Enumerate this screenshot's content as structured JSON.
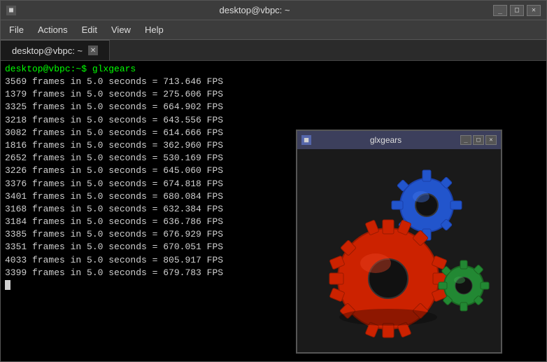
{
  "titlebar": {
    "title": "desktop@vbpc: ~",
    "min_btn": "_",
    "max_btn": "□",
    "close_btn": "✕",
    "icon": "■"
  },
  "menubar": {
    "items": [
      {
        "label": "File"
      },
      {
        "label": "Actions"
      },
      {
        "label": "Edit"
      },
      {
        "label": "View"
      },
      {
        "label": "Help"
      }
    ]
  },
  "tab": {
    "label": "desktop@vbpc: ~",
    "close": "✕"
  },
  "terminal": {
    "prompt": "desktop@vbpc:~$ glxgears",
    "lines": [
      "3569 frames in 5.0 seconds = 713.646 FPS",
      "1379 frames in 5.0 seconds = 275.606 FPS",
      "3325 frames in 5.0 seconds = 664.902 FPS",
      "3218 frames in 5.0 seconds = 643.556 FPS",
      "3082 frames in 5.0 seconds = 614.666 FPS",
      "1816 frames in 5.0 seconds = 362.960 FPS",
      "2652 frames in 5.0 seconds = 530.169 FPS",
      "3226 frames in 5.0 seconds = 645.060 FPS",
      "3376 frames in 5.0 seconds = 674.818 FPS",
      "3401 frames in 5.0 seconds = 680.084 FPS",
      "3168 frames in 5.0 seconds = 632.384 FPS",
      "3184 frames in 5.0 seconds = 636.786 FPS",
      "3385 frames in 5.0 seconds = 676.929 FPS",
      "3351 frames in 5.0 seconds = 670.051 FPS",
      "4033 frames in 5.0 seconds = 805.917 FPS",
      "3399 frames in 5.0 seconds = 679.783 FPS"
    ]
  },
  "glxgears_window": {
    "title": "glxgears",
    "icon": "■",
    "min_btn": "_",
    "max_btn": "□",
    "close_btn": "✕"
  }
}
